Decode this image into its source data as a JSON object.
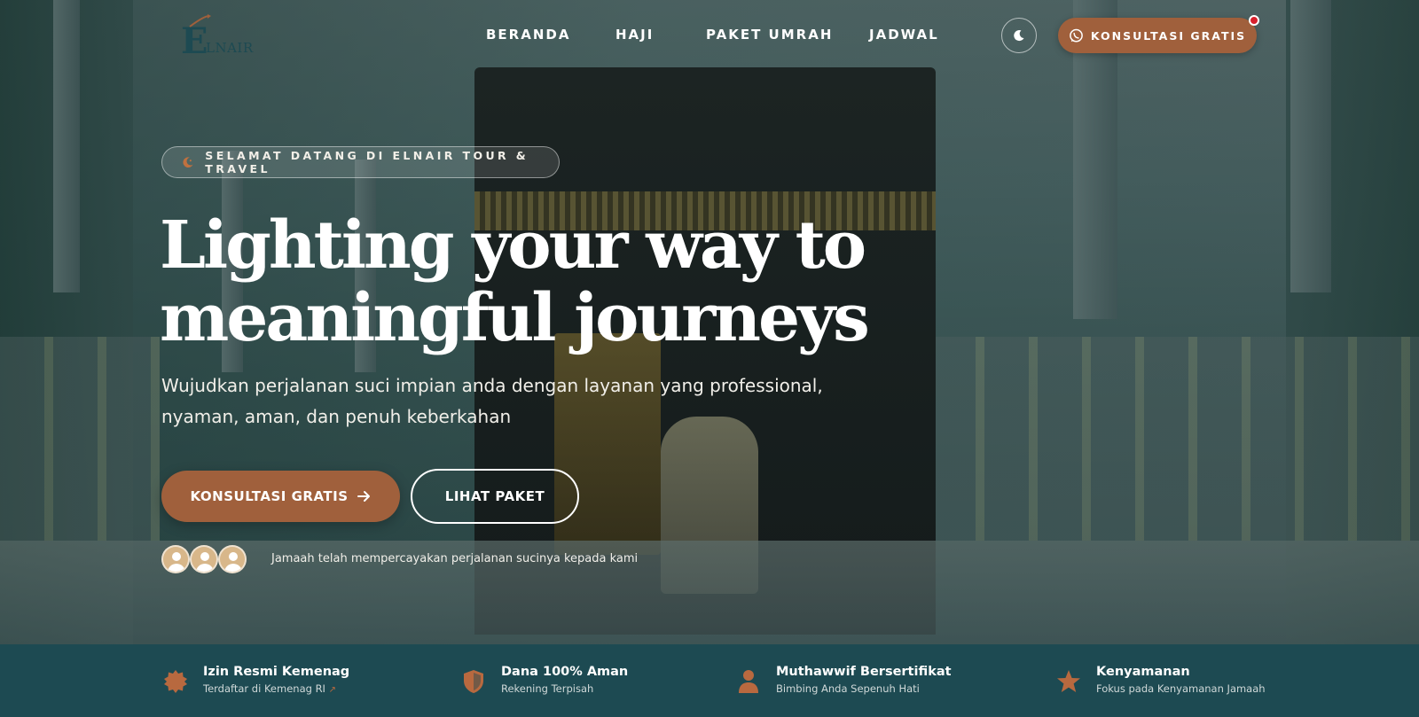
{
  "brand": {
    "logo_text": "ELNAIR",
    "logo_color": "#1d4a52",
    "accent_color": "#a0603c"
  },
  "nav": {
    "items": [
      {
        "label": "BERANDA"
      },
      {
        "label": "HAJI"
      },
      {
        "label": "PAKET UMRAH"
      },
      {
        "label": "JADWAL"
      }
    ],
    "theme_toggle_icon": "moon-icon",
    "cta_label": "KONSULTASI GRATIS",
    "cta_icon": "whatsapp-icon"
  },
  "hero": {
    "badge_text": "SELAMAT DATANG DI ELNAIR TOUR & TRAVEL",
    "badge_icon": "crescent-icon",
    "title_line1": "Lighting your way to",
    "title_line2": "meaningful journeys",
    "subtitle": "Wujudkan perjalanan suci impian anda dengan layanan yang professional, nyaman, aman, dan penuh keberkahan",
    "primary_button": "KONSULTASI GRATIS",
    "secondary_button": "LIHAT PAKET",
    "trust_text": "Jamaah telah mempercayakan perjalanan sucinya kepada kami"
  },
  "features": [
    {
      "title": "Izin Resmi Kemenag",
      "desc": "Terdaftar di Kemenag RI",
      "icon": "seal-badge-icon"
    },
    {
      "title": "Dana 100% Aman",
      "desc": "Rekening Terpisah",
      "icon": "shield-icon"
    },
    {
      "title": "Muthawwif Bersertifikat",
      "desc": "Bimbing Anda Sepenuh Hati",
      "icon": "person-icon"
    },
    {
      "title": "Kenyamanan",
      "desc": "Fokus pada Kenyamanan Jamaah",
      "icon": "star-icon"
    }
  ]
}
